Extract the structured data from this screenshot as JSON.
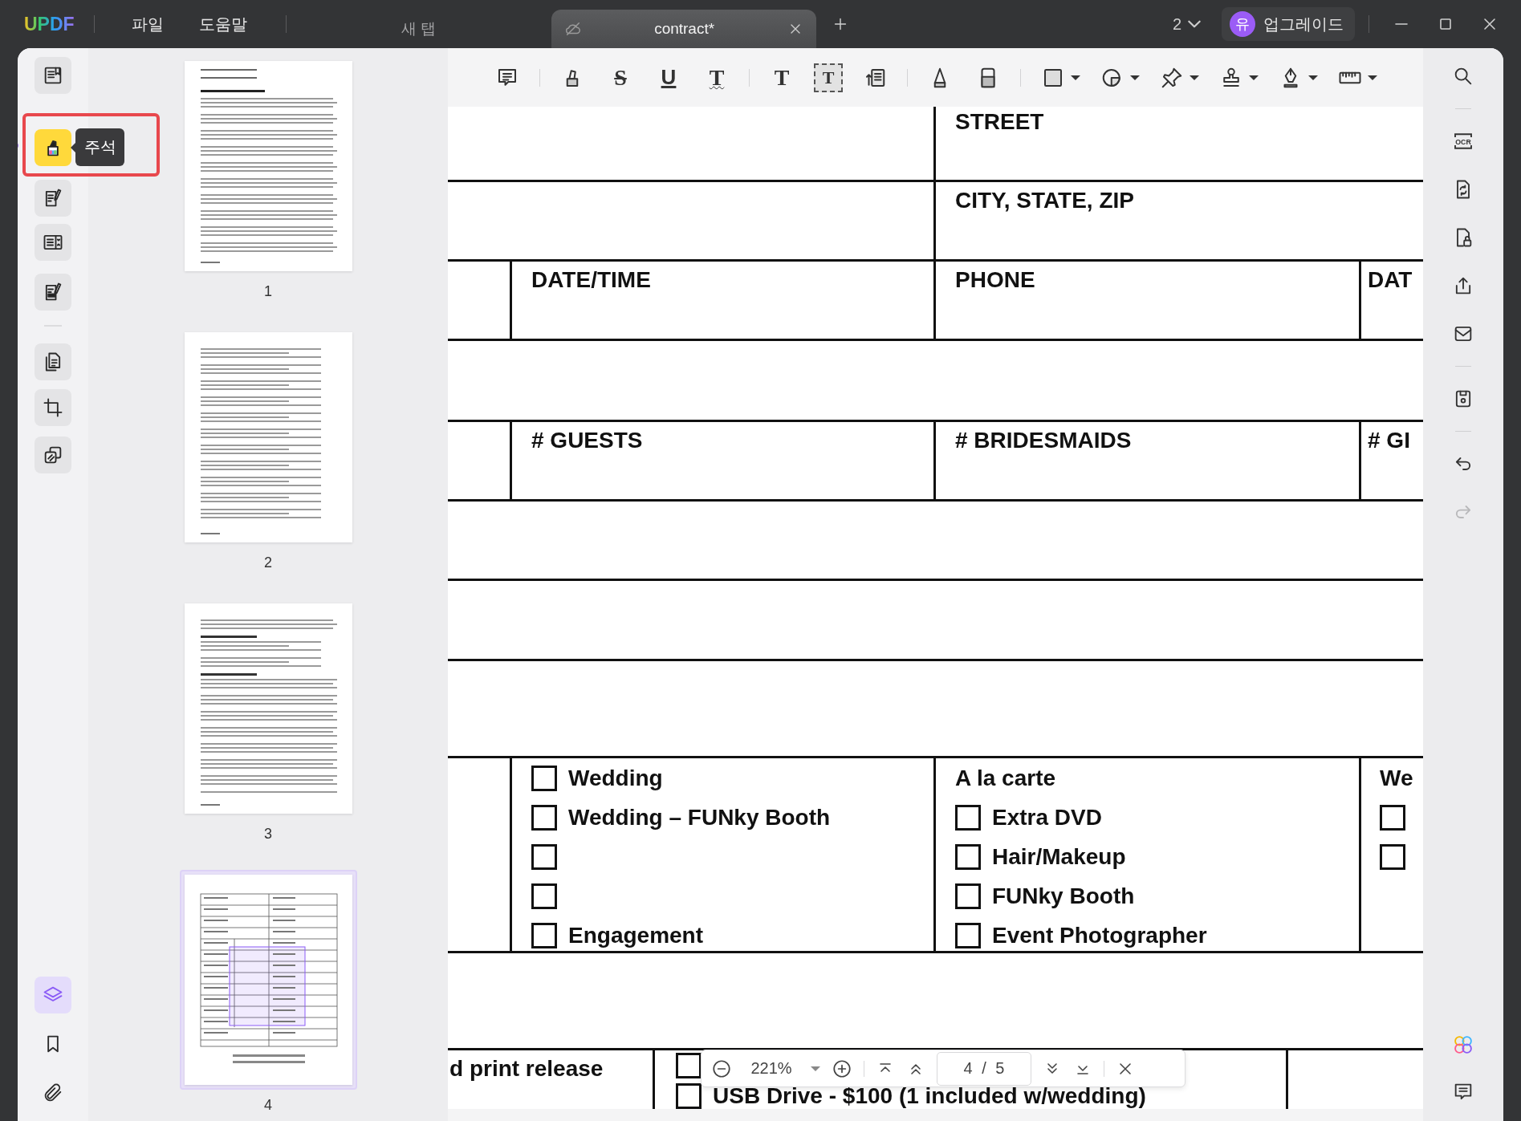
{
  "title_bar": {
    "logo": "UPDF",
    "menus": [
      {
        "label": "파일"
      },
      {
        "label": "도움말"
      }
    ],
    "tabs": [
      {
        "title": "새 탭",
        "selected": false
      },
      {
        "title": "contract*",
        "selected": true
      }
    ],
    "window_count": "2",
    "upgrade": {
      "avatar": "유",
      "label": "업그레이드"
    }
  },
  "left_rail": {
    "items": [
      {
        "kind": "read",
        "selected": false
      },
      {
        "kind": "comment",
        "selected": true
      },
      {
        "kind": "edit",
        "selected": false
      },
      {
        "kind": "form",
        "selected": false
      },
      {
        "kind": "sign",
        "selected": false
      },
      {
        "kind": "pages",
        "selected": false
      },
      {
        "kind": "crop",
        "selected": false
      },
      {
        "kind": "batch",
        "selected": false
      }
    ],
    "bottom_items": [
      {
        "kind": "layers",
        "selected": true
      },
      {
        "kind": "bookmark",
        "selected": false
      },
      {
        "kind": "attachment",
        "selected": false
      }
    ],
    "tooltip": "주석"
  },
  "thumbnails": [
    {
      "label": "1",
      "selected": false
    },
    {
      "label": "2",
      "selected": false
    },
    {
      "label": "3",
      "selected": false
    },
    {
      "label": "4",
      "selected": true
    }
  ],
  "annotation_toolbar": [
    {
      "kind": "note"
    },
    {
      "kind": "highlight"
    },
    {
      "kind": "strike",
      "glyph": "S"
    },
    {
      "kind": "underline",
      "glyph": "U"
    },
    {
      "kind": "squiggly",
      "glyph": "T"
    },
    {
      "kind": "text",
      "glyph": "T"
    },
    {
      "kind": "textbox",
      "glyph": "T"
    },
    {
      "kind": "callout"
    },
    {
      "kind": "pencil"
    },
    {
      "kind": "eraser"
    },
    {
      "kind": "rectangle",
      "dropdown": true
    },
    {
      "kind": "shape",
      "dropdown": true
    },
    {
      "kind": "pin",
      "dropdown": true
    },
    {
      "kind": "stamp",
      "dropdown": true
    },
    {
      "kind": "signature",
      "dropdown": true
    },
    {
      "kind": "measure",
      "dropdown": true
    }
  ],
  "document": {
    "rows": [
      {
        "kind": "address",
        "cells": [
          {
            "text": "STREET"
          }
        ]
      },
      {
        "kind": "address",
        "cells": [
          {
            "text": "CITY, STATE, ZIP"
          }
        ]
      },
      {
        "kind": "grid",
        "cells": [
          {
            "text": "DATE/TIME"
          },
          {
            "text": "PHONE"
          },
          {
            "text": "DAT"
          }
        ]
      },
      {
        "kind": "blank"
      },
      {
        "kind": "grid",
        "cells": [
          {
            "text": "# GUESTS"
          },
          {
            "text": "# BRIDESMAIDS"
          },
          {
            "text": "# GI"
          }
        ]
      },
      {
        "kind": "blank"
      },
      {
        "kind": "blank"
      },
      {
        "kind": "blank"
      },
      {
        "kind": "grid",
        "cells": [
          {
            "items": [
              {
                "label": "Wedding",
                "checked": false
              },
              {
                "label": "Wedding – FUNky Booth",
                "checked": false
              },
              {
                "checked": false
              },
              {
                "checked": false
              },
              {
                "label": "Engagement",
                "checked": false
              }
            ]
          },
          {
            "heading": "A la carte",
            "items": [
              {
                "label": "Extra DVD",
                "checked": false
              },
              {
                "label": "Hair/Makeup",
                "checked": false
              },
              {
                "label": "FUNky Booth",
                "checked": false
              },
              {
                "label": "Event Photographer",
                "checked": false
              }
            ]
          },
          {
            "heading": "We",
            "items": [
              {
                "checked": false
              },
              {
                "checked": false
              }
            ]
          }
        ]
      },
      {
        "kind": "blank"
      },
      {
        "kind": "release",
        "cells": [
          {
            "text": "d print release"
          },
          {
            "items": [
              {
                "checked": false
              },
              {
                "label": "USB Drive - $100 (1 included w/wedding)",
                "checked": false
              }
            ]
          }
        ]
      }
    ]
  },
  "zoom_bar": {
    "zoom": "221%",
    "page": "4 / 5"
  },
  "right_rail": {
    "items": [
      {
        "kind": "search",
        "disabled": false
      },
      {
        "kind": "ocr",
        "glyph": "OCR",
        "disabled": false
      },
      {
        "kind": "convert",
        "disabled": false
      },
      {
        "kind": "protect",
        "disabled": false
      },
      {
        "kind": "share",
        "disabled": false
      },
      {
        "kind": "mail",
        "disabled": false
      },
      {
        "kind": "save",
        "disabled": false
      },
      {
        "kind": "undo",
        "disabled": false
      },
      {
        "kind": "redo",
        "disabled": true
      }
    ],
    "bottom_items": [
      {
        "kind": "ai"
      },
      {
        "kind": "comments"
      }
    ]
  }
}
